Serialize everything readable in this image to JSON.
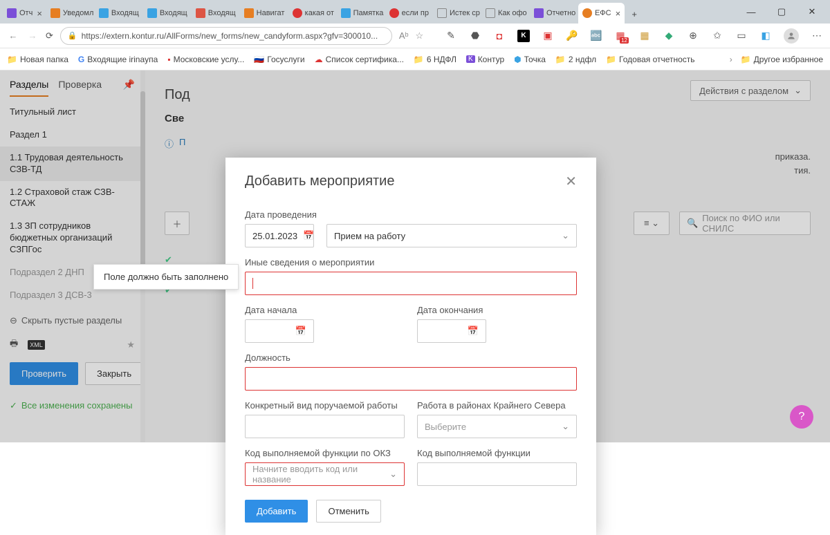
{
  "tabs": [
    {
      "label": "Отч",
      "color": "#7b4fd8"
    },
    {
      "label": "Уведомл",
      "color": "#e67e22"
    },
    {
      "label": "Входящ",
      "color": "#3aa3e3"
    },
    {
      "label": "Входящ",
      "color": "#3aa3e3"
    },
    {
      "label": "Входящ",
      "color": "#d54"
    },
    {
      "label": "Навигат",
      "color": "#e67e22"
    },
    {
      "label": "какая от",
      "color": "#d33"
    },
    {
      "label": "Памятка",
      "color": "#3aa3e3"
    },
    {
      "label": "если пр",
      "color": "#d33"
    },
    {
      "label": "Истек ср",
      "color": "#555"
    },
    {
      "label": "Как офо",
      "color": "#555"
    },
    {
      "label": "Отчетно",
      "color": "#7b4fd8"
    },
    {
      "label": "ЕФС",
      "color": "#e67e22",
      "active": true
    }
  ],
  "new_tab": "+",
  "url": "https://extern.kontur.ru/AllForms/new_forms/new_candyform.aspx?gfv=300010...",
  "bookmarks": [
    {
      "label": "Новая папка",
      "icon": "folder"
    },
    {
      "label": "Входящие irinayпа",
      "icon": "g"
    },
    {
      "label": "Московские услу...",
      "icon": "doc"
    },
    {
      "label": "Госуслуги",
      "icon": "flag"
    },
    {
      "label": "Список сертифика...",
      "icon": "cloud"
    },
    {
      "label": "6 НДФЛ",
      "icon": "folder"
    },
    {
      "label": "Контур",
      "icon": "k"
    },
    {
      "label": "Точка",
      "icon": "t"
    },
    {
      "label": "2 ндфл",
      "icon": "folder"
    },
    {
      "label": "Годовая отчетность",
      "icon": "folder"
    }
  ],
  "bookmark_more": "Другое избранное",
  "sidebar": {
    "tabs": [
      "Разделы",
      "Проверка"
    ],
    "items": [
      {
        "label": "Титульный лист"
      },
      {
        "label": "Раздел 1"
      },
      {
        "label": "1.1 Трудовая деятельность СЗВ-ТД",
        "selected": true
      },
      {
        "label": "1.2 Страховой стаж СЗВ-СТАЖ"
      },
      {
        "label": "1.3 ЗП сотрудников бюджетных организаций СЗПГос"
      },
      {
        "label": "Подраздел 2 ДНП",
        "muted": true
      },
      {
        "label": "Подраздел 3 ДСВ-3",
        "muted": true
      }
    ],
    "collapse": "Скрыть пустые разделы",
    "check_btn": "Проверить",
    "close_btn": "Закрыть",
    "saved": "Все изменения сохранены"
  },
  "main": {
    "actions_label": "Действия с разделом",
    "h2": "Под",
    "h3": "Све",
    "hint": "П",
    "para1": "приказа.",
    "para2": "тия.",
    "search_placeholder": "Поиск по ФИО или СНИЛС"
  },
  "tooltip": "Поле должно быть заполнено",
  "modal": {
    "title": "Добавить мероприятие",
    "date_label": "Дата проведения",
    "date_value": "25.01.2023",
    "type_value": "Прием на работу",
    "other_label": "Иные сведения о мероприятии",
    "start_label": "Дата начала",
    "end_label": "Дата окончания",
    "position_label": "Должность",
    "work_kind_label": "Конкретный вид поручаемой работы",
    "north_label": "Работа в районах Крайнего Севера",
    "north_placeholder": "Выберите",
    "okz_label": "Код выполняемой функции по ОКЗ",
    "okz_placeholder": "Начните вводить код или название",
    "func_label": "Код выполняемой функции",
    "add_btn": "Добавить",
    "cancel_btn": "Отменить"
  },
  "fab": "?"
}
